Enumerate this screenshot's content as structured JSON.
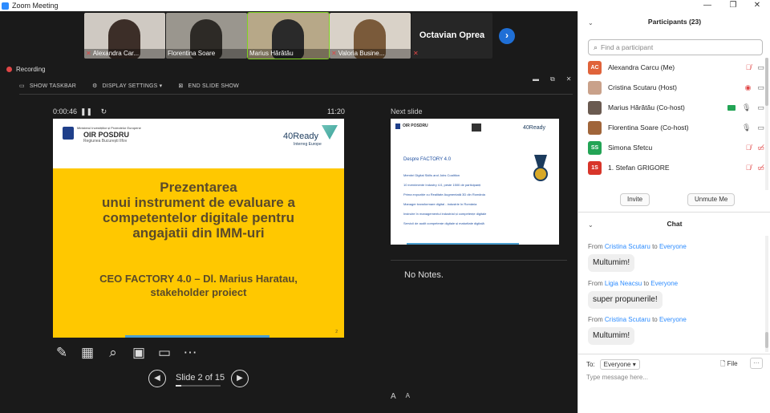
{
  "window": {
    "title": "Zoom Meeting",
    "controls": [
      "—",
      "❐",
      "✕"
    ]
  },
  "gallery": {
    "tiles": [
      {
        "name": "Alexandra Car...",
        "muted": true,
        "bg": "#cfc9c2",
        "person": "#3c2e28"
      },
      {
        "name": "Florentina Soare",
        "muted": false,
        "bg": "#9a968e",
        "person": "#2d2a26"
      },
      {
        "name": "Marius Hărătău",
        "muted": false,
        "bg": "#b7a888",
        "person": "#2a2a2a"
      },
      {
        "name": "Valoria Busine...",
        "muted": true,
        "bg": "#d9d2c8",
        "person": "#7a5a3a"
      },
      {
        "name": "",
        "muted": true,
        "display_name": "Octavian Oprea"
      }
    ],
    "next_label": "›"
  },
  "recording": {
    "label": "Recording"
  },
  "window_ctls": [
    "▬",
    "⧉",
    "✕"
  ],
  "ppt_toolbar": {
    "show_taskbar": "SHOW TASKBAR",
    "display_settings": "DISPLAY SETTINGS ▾",
    "end_show": "END SLIDE SHOW"
  },
  "presenter": {
    "elapsed": "0:00:46",
    "pause": "❚❚",
    "reset": "↻",
    "clock": "11:20",
    "next_slide_label": "Next slide",
    "slide_counter": "Slide 2 of 15",
    "notes": "No Notes.",
    "font_up": "A",
    "font_down": "A",
    "progress": 0.133
  },
  "slide": {
    "ministry": "Ministerul Investițiilor și Proiectelor Europene",
    "oir": "OIR POSDRU",
    "oir_sub": "Regiunea București Ilfov",
    "brand": "40Ready",
    "brand_sub": "Interreg Europe",
    "title_lines": [
      "Prezentarea",
      "unui instrument de evaluare a",
      "competentelor digitale pentru",
      "angajatii din  IMM-uri"
    ],
    "subtitle_lines": [
      "CEO FACTORY 4.0 – Dl. Marius Haratau,",
      "stakeholder proiect"
    ],
    "page": "2"
  },
  "next_slide": {
    "oir": "OIR POSDRU",
    "brand": "40Ready",
    "title": "Despre FACTORY 4.0",
    "lines": [
      "Membri Digital Skills and Jobs Coalition",
      "10 evenimente Industry 4.0, peste 1500 de participanți",
      "Prima expoziție cu Realitate Augmentată 3D din România",
      "Manager transformare digital - industrie în România",
      "Instruire în managementul industrial și competențe digitale",
      "Servicii de audit competențe digitale și maturitate digitală"
    ]
  },
  "participants": {
    "header": "Participants (23)",
    "search_placeholder": "Find a participant",
    "list": [
      {
        "initials": "AC",
        "color": "#e0633a",
        "name": "Alexandra Carcu (Me)",
        "mic": "muted",
        "cam": "on"
      },
      {
        "initials": "",
        "color": "#c9a18a",
        "name": "Cristina Scutaru (Host)",
        "mic": "rec",
        "cam": "on"
      },
      {
        "initials": "",
        "color": "#6a5a50",
        "name": "Marius Hărătău (Co-host)",
        "mic": "on",
        "cam": "green"
      },
      {
        "initials": "",
        "color": "#a0653a",
        "name": "Florentina Soare (Co-host)",
        "mic": "on",
        "cam": "on"
      },
      {
        "initials": "SS",
        "color": "#23a455",
        "name": "Simona Sfetcu",
        "mic": "muted",
        "cam": "off"
      },
      {
        "initials": "1S",
        "color": "#d8352a",
        "name": "1. Stefan GRIGORE",
        "mic": "muted",
        "cam": "off"
      }
    ],
    "invite": "Invite",
    "unmute": "Unmute Me"
  },
  "chat": {
    "header": "Chat",
    "messages": [
      {
        "from": "Cristina Scutaru",
        "to": "Everyone",
        "text": "Multumim!"
      },
      {
        "from": "Ligia Neacsu",
        "to": "Everyone",
        "text": "super propunerile!"
      },
      {
        "from": "Cristina Scutaru",
        "to": "Everyone",
        "text": "Multumim!"
      }
    ],
    "from_label": "From",
    "to_word": "to",
    "to_label": "To:",
    "recipient": "Everyone ▾",
    "file": "File",
    "more": "···",
    "placeholder": "Type message here..."
  }
}
